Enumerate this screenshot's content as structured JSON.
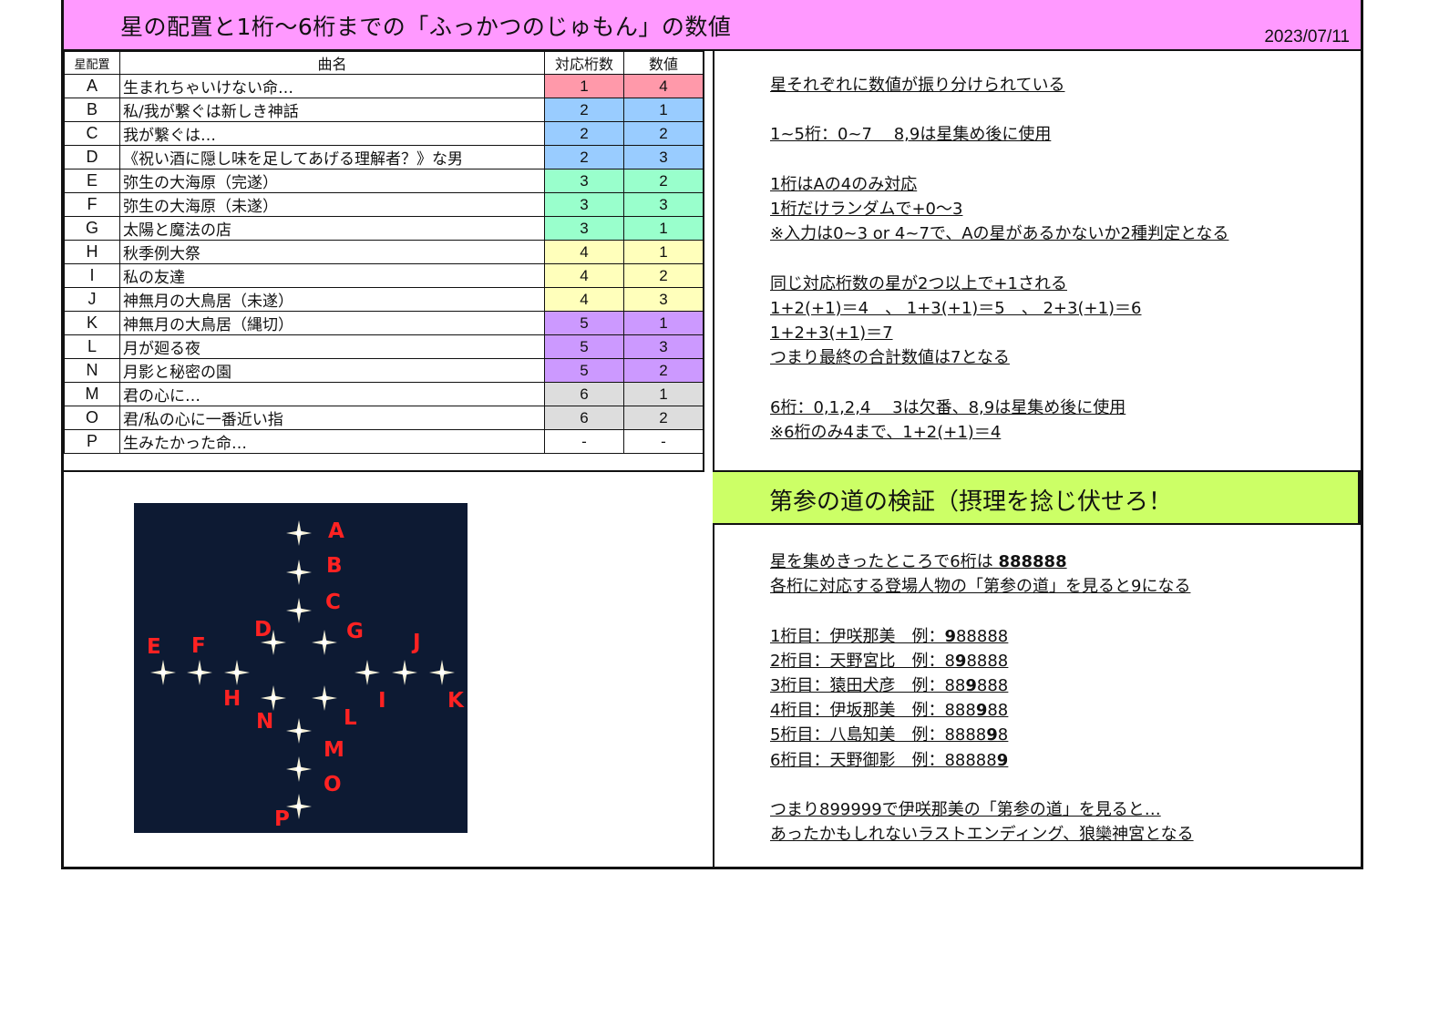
{
  "title": "星の配置と1桁～6桁までの「ふっかつのじゅもん」の数値",
  "date": "2023/07/11",
  "table": {
    "headers": [
      "星配置",
      "曲名",
      "対応桁数",
      "数値"
    ],
    "rows": [
      {
        "letter": "A",
        "song": "生まれちゃいけない命…",
        "digit": "1",
        "value": "4",
        "color": "#ff99aa"
      },
      {
        "letter": "B",
        "song": "私/我が繋ぐは新しき神話",
        "digit": "2",
        "value": "1",
        "color": "#99ccff"
      },
      {
        "letter": "C",
        "song": "我が繋ぐは…",
        "digit": "2",
        "value": "2",
        "color": "#99ccff"
      },
      {
        "letter": "D",
        "song": "《祝い酒に隠し味を足してあげる理解者？》な男",
        "digit": "2",
        "value": "3",
        "color": "#99ccff"
      },
      {
        "letter": "E",
        "song": "弥生の大海原（完遂）",
        "digit": "3",
        "value": "2",
        "color": "#99ffcc"
      },
      {
        "letter": "F",
        "song": "弥生の大海原（未遂）",
        "digit": "3",
        "value": "3",
        "color": "#99ffcc"
      },
      {
        "letter": "G",
        "song": "太陽と魔法の店",
        "digit": "3",
        "value": "1",
        "color": "#99ffcc"
      },
      {
        "letter": "H",
        "song": "秋季例大祭",
        "digit": "4",
        "value": "1",
        "color": "#ffffbb"
      },
      {
        "letter": "I",
        "song": "私の友達",
        "digit": "4",
        "value": "2",
        "color": "#ffffbb"
      },
      {
        "letter": "J",
        "song": "神無月の大鳥居（未遂）",
        "digit": "4",
        "value": "3",
        "color": "#ffffbb"
      },
      {
        "letter": "K",
        "song": "神無月の大鳥居（縄切）",
        "digit": "5",
        "value": "1",
        "color": "#cc99ff"
      },
      {
        "letter": "L",
        "song": "月が廻る夜",
        "digit": "5",
        "value": "3",
        "color": "#cc99ff"
      },
      {
        "letter": "N",
        "song": "月影と秘密の園",
        "digit": "5",
        "value": "2",
        "color": "#cc99ff"
      },
      {
        "letter": "M",
        "song": "君の心に…",
        "digit": "6",
        "value": "1",
        "color": "#dddddd"
      },
      {
        "letter": "O",
        "song": "君/私の心に一番近い指",
        "digit": "6",
        "value": "2",
        "color": "#dddddd"
      },
      {
        "letter": "P",
        "song": "生みたかった命…",
        "digit": "-",
        "value": "-",
        "color": "#ffffff"
      }
    ]
  },
  "notes": [
    "星それぞれに数値が振り分けられている",
    "",
    "1~5桁：0~7　 8,9は星集め後に使用",
    "",
    "1桁はAの4のみ対応",
    "1桁だけランダムで+0～3",
    "※入力は0~3 or 4~7で、Aの星があるかないか2種判定となる",
    "",
    "同じ対応桁数の星が2つ以上で+1される",
    "1+2(+1)＝4　、 1+3(+1)＝5　、 2+3(+1)＝6",
    "1+2+3(+1)＝7",
    "つまり最終の合計数値は7となる",
    "",
    "6桁：0,1,2,4　 3は欠番、8,9は星集め後に使用",
    "※6桁のみ4まで、1+2(+1)＝4"
  ],
  "banner": "第参の道の検証（摂理を捻じ伏せろ！",
  "verify": {
    "line1_pre": "星を集めきったところで6桁は ",
    "line1_bold": "888888",
    "line2": "各桁に対応する登場人物の「第参の道」を見ると9になる",
    "digits": [
      {
        "label": "1桁目：伊咲那美　例：",
        "pre": "",
        "bold": "9",
        "post": "88888"
      },
      {
        "label": "2桁目：天野宮比　例：",
        "pre": "8",
        "bold": "9",
        "post": "8888"
      },
      {
        "label": "3桁目：猿田犬彦　例：",
        "pre": "88",
        "bold": "9",
        "post": "888"
      },
      {
        "label": "4桁目：伊坂那美　例：",
        "pre": "888",
        "bold": "9",
        "post": "88"
      },
      {
        "label": "5桁目：八島知美　例：",
        "pre": "8888",
        "bold": "9",
        "post": "8"
      },
      {
        "label": "6桁目：天野御影　例：",
        "pre": "88888",
        "bold": "9",
        "post": ""
      }
    ],
    "end1": "つまり899999で伊咲那美の「第参の道」を見ると…",
    "end2": "あったかもしれないラストエンディング、狼欒神宮となる"
  },
  "starmap": {
    "labels": [
      "A",
      "B",
      "C",
      "D",
      "G",
      "E",
      "F",
      "J",
      "H",
      "N",
      "I",
      "K",
      "L",
      "M",
      "O",
      "P"
    ],
    "label_color": "#ff2222",
    "star_color": "#f5f0d8",
    "background": "#0d1a33"
  }
}
